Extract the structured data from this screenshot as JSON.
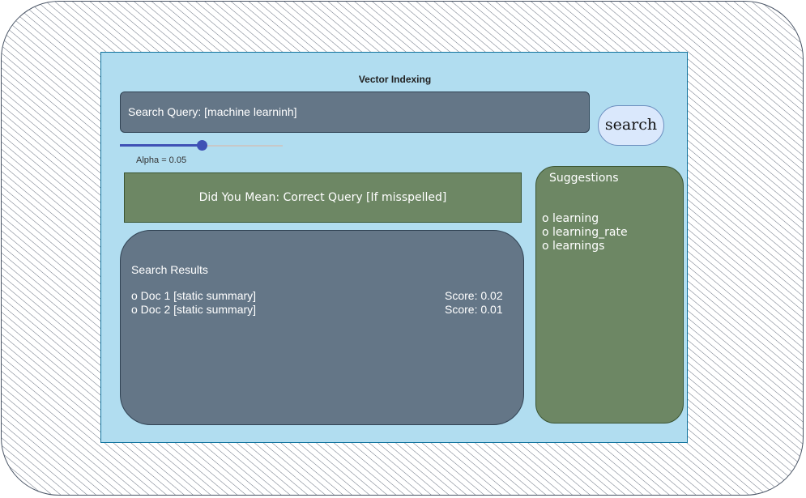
{
  "panel": {
    "title": "Vector Indexing"
  },
  "query": {
    "label": "Search Query: [machine learninh]"
  },
  "search_button": {
    "label": "search"
  },
  "alpha": {
    "label": "Alpha = 0.05",
    "slider_fraction": 0.5
  },
  "did_you_mean": {
    "text": "Did You Mean: Correct Query [If misspelled]"
  },
  "results": {
    "title": "Search Results",
    "items": [
      {
        "name": "o Doc 1 [static summary]",
        "score": "Score: 0.02"
      },
      {
        "name": "o Doc 2 [static summary]",
        "score": "Score: 0.01"
      }
    ]
  },
  "suggestions": {
    "title": "Suggestions",
    "items": [
      "o learning",
      "o learning_rate",
      "o learnings"
    ]
  },
  "colors": {
    "panel_bg": "#b1ddf0",
    "slate": "#647687",
    "green": "#6d8764",
    "button_bg": "#dae8fc",
    "slider_accent": "#3f51b5"
  }
}
